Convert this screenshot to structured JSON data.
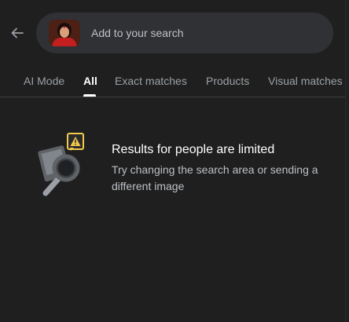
{
  "search": {
    "placeholder": "Add to your search",
    "thumbnail_alt": "uploaded-image-thumbnail"
  },
  "tabs": [
    {
      "label": "AI Mode",
      "active": false
    },
    {
      "label": "All",
      "active": true
    },
    {
      "label": "Exact matches",
      "active": false
    },
    {
      "label": "Products",
      "active": false
    },
    {
      "label": "Visual matches",
      "active": false
    }
  ],
  "notice": {
    "title": "Results for people are limited",
    "body": "Try changing the search area or sending a different image"
  },
  "colors": {
    "background": "#1f1f1f",
    "search_box": "#303134",
    "warning": "#f2c94c"
  },
  "icons": {
    "back": "arrow-left-icon",
    "illustration": "photo-magnifier-warning-illustration"
  }
}
